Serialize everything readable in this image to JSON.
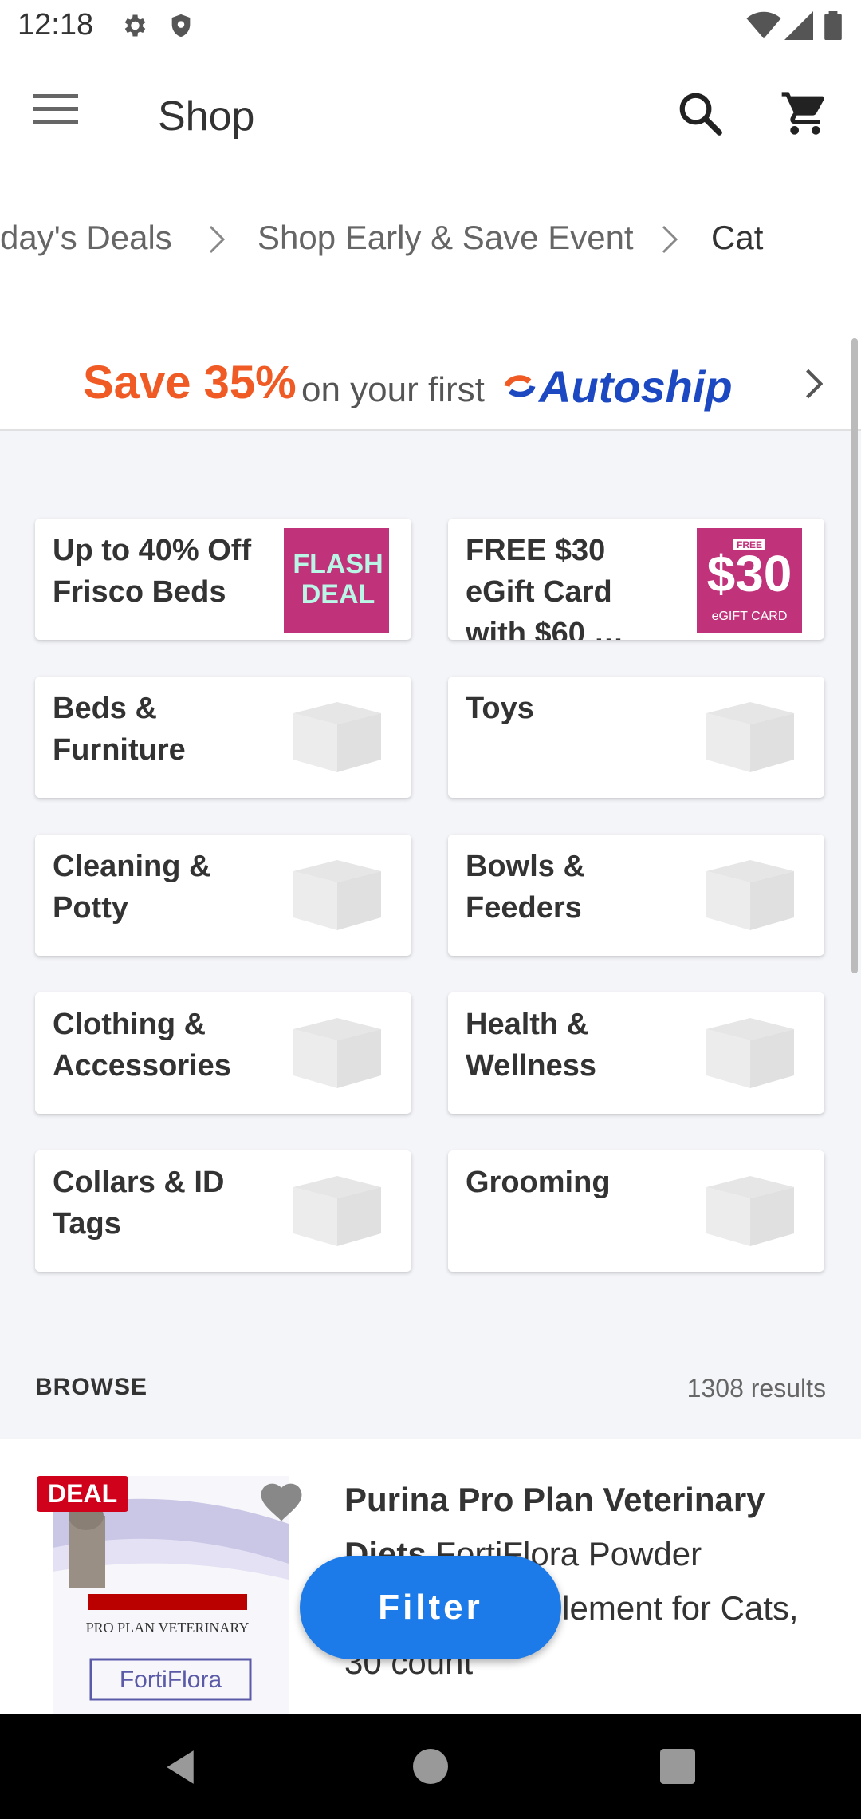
{
  "status_bar": {
    "time": "12:18",
    "icons": [
      "gear-icon",
      "shield-icon",
      "wifi-icon",
      "signal-icon",
      "battery-icon"
    ]
  },
  "app_bar": {
    "title": "Shop",
    "icons": [
      "menu-icon",
      "search-icon",
      "cart-icon"
    ]
  },
  "breadcrumb": {
    "items": [
      "day's Deals",
      "Shop Early & Save Event",
      "Cat"
    ]
  },
  "autoship_banner": {
    "save": "Save 35%",
    "text": "on your first",
    "brand": "Autoship",
    "colors": {
      "save": "#f05a24",
      "brand": "#1c49c2"
    }
  },
  "tiles": [
    {
      "label": "Up to 40% Off Frisco Beds",
      "image": "flash-deal",
      "image_text": "FLASH DEAL"
    },
    {
      "label": "FREE $30 eGift Card with $60 …",
      "image": "egift-card",
      "image_text": "$30",
      "image_free": "FREE",
      "image_sub": "eGIFT CARD"
    },
    {
      "label": "Beds & Furniture",
      "image": "chewy-box"
    },
    {
      "label": "Toys",
      "image": "chewy-box"
    },
    {
      "label": "Cleaning & Potty",
      "image": "chewy-box"
    },
    {
      "label": "Bowls & Feeders",
      "image": "chewy-box"
    },
    {
      "label": "Clothing & Accessories",
      "image": "chewy-box"
    },
    {
      "label": "Health & Wellness",
      "image": "chewy-box"
    },
    {
      "label": "Collars & ID Tags",
      "image": "chewy-box"
    },
    {
      "label": "Grooming",
      "image": "chewy-box"
    }
  ],
  "browse": {
    "label": "BROWSE",
    "results": "1308 results"
  },
  "product": {
    "badge": "DEAL",
    "title_bold": "Purina Pro Plan Veterinary Diets",
    "title_rest": "FortiFlora Powder Probiotic Supplement for Cats, 30 count",
    "image_brand": "PRO PLAN VETERINARY SUPPLEMENTS",
    "image_name": "FortiFlora"
  },
  "filter": {
    "label": "Filter",
    "color": "#1c7be8"
  },
  "nav_bar": {
    "icons": [
      "back-icon",
      "home-icon",
      "recents-icon"
    ]
  }
}
